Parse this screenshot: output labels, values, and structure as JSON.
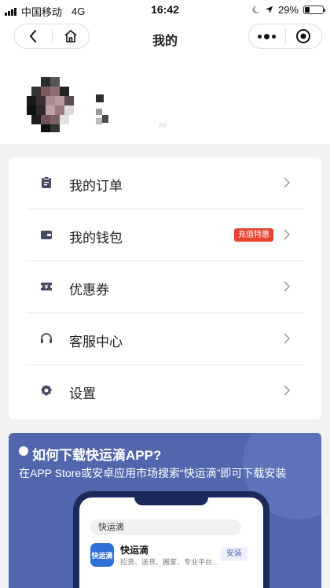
{
  "status_bar": {
    "carrier": "中国移动",
    "network": "4G",
    "time": "16:42",
    "battery": "29%",
    "battery_level": 0.29
  },
  "nav": {
    "title": "我的",
    "back_icon": "chevron-left-icon",
    "home_icon": "home-icon",
    "more_icon": "more-dots-icon",
    "close_icon": "target-close-icon"
  },
  "menu": {
    "items": [
      {
        "label": "我的订单",
        "icon": "clipboard-icon"
      },
      {
        "label": "我的钱包",
        "icon": "wallet-icon",
        "badge": "充值特惠"
      },
      {
        "label": "优惠券",
        "icon": "ticket-icon"
      },
      {
        "label": "客服中心",
        "icon": "headset-icon"
      },
      {
        "label": "设置",
        "icon": "gear-icon"
      }
    ]
  },
  "banner": {
    "title": "如何下载快运滴APP?",
    "desc": "在APP Store或安卓应用市场搜索“快运滴”即可下载安装",
    "phone": {
      "search_text": "快运滴",
      "logo_text": "快运滴",
      "app_name": "快运滴",
      "app_desc": "拉货、送货、搬家、专业平台...",
      "install": "安装"
    }
  },
  "colors": {
    "badge": "#e64334",
    "banner": "#5266ad",
    "icon": "#454a60"
  }
}
